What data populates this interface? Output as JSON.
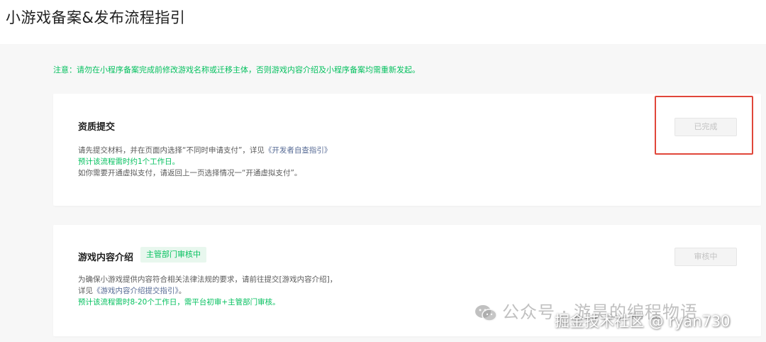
{
  "page": {
    "title": "小游戏备案&发布流程指引",
    "notice": "注意：请勿在小程序备案完成前修改游戏名称或迁移主体，否则游戏内容介绍及小程序备案均需重新发起。"
  },
  "steps": [
    {
      "title": "资质提交",
      "button_label": "已完成",
      "desc_line1_text": "请先提交材料，并在页面内选择“不同时申请支付”，详见",
      "desc_line1_link": "《开发者自查指引》",
      "desc_line2": "预计该流程需时约1个工作日。",
      "desc_line3": "如你需要开通虚拟支付，请返回上一页选择情况一“开通虚拟支付”。"
    },
    {
      "title": "游戏内容介绍",
      "status_tag": "主管部门审核中",
      "button_label": "审核中",
      "desc_line1": "为确保小游戏提供内容符合相关法律法规的要求，请前往提交[游戏内容介绍]，",
      "desc_line2_prefix": "详见",
      "desc_line2_link": "《游戏内容介绍提交指引》",
      "desc_line2_suffix": "。",
      "desc_line3": "预计该流程需时8-20个工作日，需平台初审+主管部门审核。"
    }
  ],
  "watermarks": {
    "wechat": "公众号 · 游昊的编程物语",
    "juejin": "掘金技术社区 @ ryan730"
  },
  "colors": {
    "accent_green": "#07c160",
    "link_blue": "#576b95",
    "highlight_red": "#e0463a"
  }
}
